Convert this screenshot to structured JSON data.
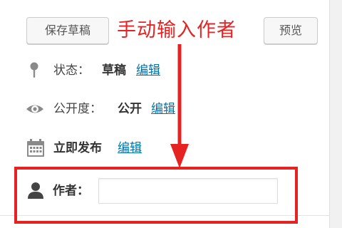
{
  "toolbar": {
    "save_draft_label": "保存草稿",
    "preview_label": "预览"
  },
  "annotation": {
    "text": "手动输入作者",
    "color": "#e52323"
  },
  "status": {
    "icon": "pin-icon",
    "label": "状态：",
    "value": "草稿",
    "edit_label": "编辑"
  },
  "visibility": {
    "icon": "eye-icon",
    "label": "公开度：",
    "value": "公开",
    "edit_label": "编辑"
  },
  "publish": {
    "icon": "calendar-icon",
    "value": "立即发布",
    "edit_label": "编辑"
  },
  "author": {
    "icon": "user-icon",
    "label": "作者：",
    "value": "",
    "placeholder": ""
  },
  "colors": {
    "link": "#0073aa",
    "annotation_red": "#e52323"
  }
}
